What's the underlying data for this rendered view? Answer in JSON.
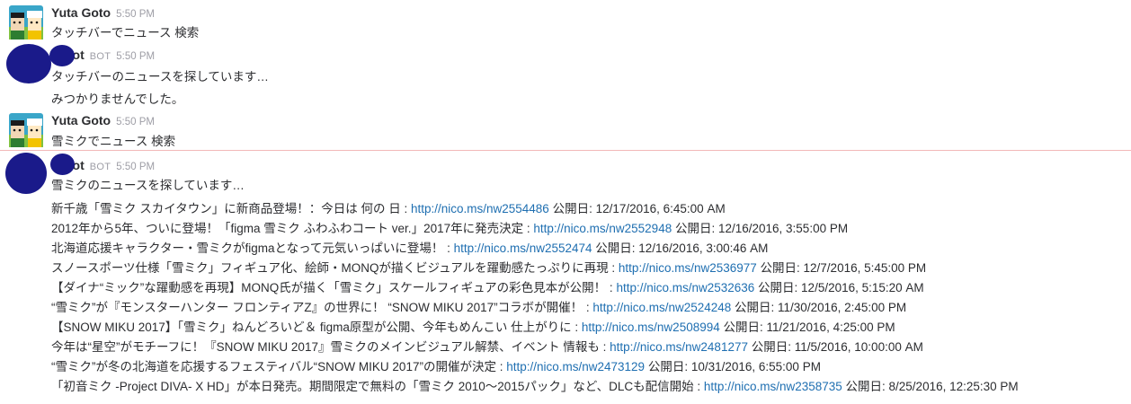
{
  "messages": [
    {
      "sender": "Yuta Goto",
      "time": "5:50 PM",
      "avatar_icon": "cartoon-avatar-icon",
      "text": "タッチバーでニュース 検索"
    },
    {
      "sender": "bot",
      "bot_label": "BOT",
      "time": "5:50 PM",
      "lines": [
        "タッチバーのニュースを探しています…",
        "みつかりませんでした。"
      ]
    },
    {
      "sender": "Yuta Goto",
      "time": "5:50 PM",
      "avatar_icon": "cartoon-avatar-icon",
      "text": "雪ミクでニュース 検索"
    },
    {
      "sender": "bot",
      "bot_label": "BOT",
      "time": "5:50 PM",
      "intro": "雪ミクのニュースを探しています…",
      "results": [
        {
          "title": "新千歳「雪ミク スカイタウン」に新商品登場！：今日は 何の 日 : ",
          "url": "http://nico.ms/nw2554486",
          "date": " 公開日: 12/17/2016, 6:45:00 AM"
        },
        {
          "title": "2012年から5年、ついに登場！「figma 雪ミク ふわふわコート ver.」2017年に発売決定 : ",
          "url": "http://nico.ms/nw2552948",
          "date": " 公開日: 12/16/2016, 3:55:00 PM"
        },
        {
          "title": "北海道応援キャラクター・雪ミクがfigmaとなって元気いっぱいに登場！ : ",
          "url": "http://nico.ms/nw2552474",
          "date": " 公開日: 12/16/2016, 3:00:46 AM"
        },
        {
          "title": "スノースポーツ仕様「雪ミク」フィギュア化、絵師・MONQが描くビジュアルを躍動感たっぷりに再現 : ",
          "url": "http://nico.ms/nw2536977",
          "date": " 公開日: 12/7/2016, 5:45:00 PM"
        },
        {
          "title": "【ダイナ“ミック”な躍動感を再現】MONQ氏が描く「雪ミク」スケールフィギュアの彩色見本が公開！ : ",
          "url": "http://nico.ms/nw2532636",
          "date": " 公開日: 12/5/2016, 5:15:20 AM"
        },
        {
          "title": "“雪ミク”が『モンスターハンター フロンティアZ』の世界に！ “SNOW MIKU 2017”コラボが開催！ : ",
          "url": "http://nico.ms/nw2524248",
          "date": " 公開日: 11/30/2016, 2:45:00 PM"
        },
        {
          "title": "【SNOW MIKU 2017】「雪ミク」ねんどろいど＆ figma原型が公開、今年もめんこい 仕上がりに : ",
          "url": "http://nico.ms/nw2508994",
          "date": " 公開日: 11/21/2016, 4:25:00 PM"
        },
        {
          "title": "今年は“星空”がモチーフに！『SNOW MIKU 2017』雪ミクのメインビジュアル解禁、イベント 情報も : ",
          "url": "http://nico.ms/nw2481277",
          "date": " 公開日: 11/5/2016, 10:00:00 AM"
        },
        {
          "title": "“雪ミク”が冬の北海道を応援するフェスティバル“SNOW MIKU 2017”の開催が決定 : ",
          "url": "http://nico.ms/nw2473129",
          "date": " 公開日: 10/31/2016, 6:55:00 PM"
        },
        {
          "title": "「初音ミク -Project DIVA- X HD」が本日発売。期間限定で無料の「雪ミク 2010〜2015パック」など、DLCも配信開始 : ",
          "url": "http://nico.ms/nw2358735",
          "date": " 公開日: 8/25/2016, 12:25:30 PM"
        }
      ]
    }
  ],
  "colors": {
    "link": "#1f6fb1",
    "text": "#2c2d30",
    "muted": "#9e9ea6",
    "new_divider": "#f2b9b9",
    "redaction": "#1a1a8a"
  }
}
